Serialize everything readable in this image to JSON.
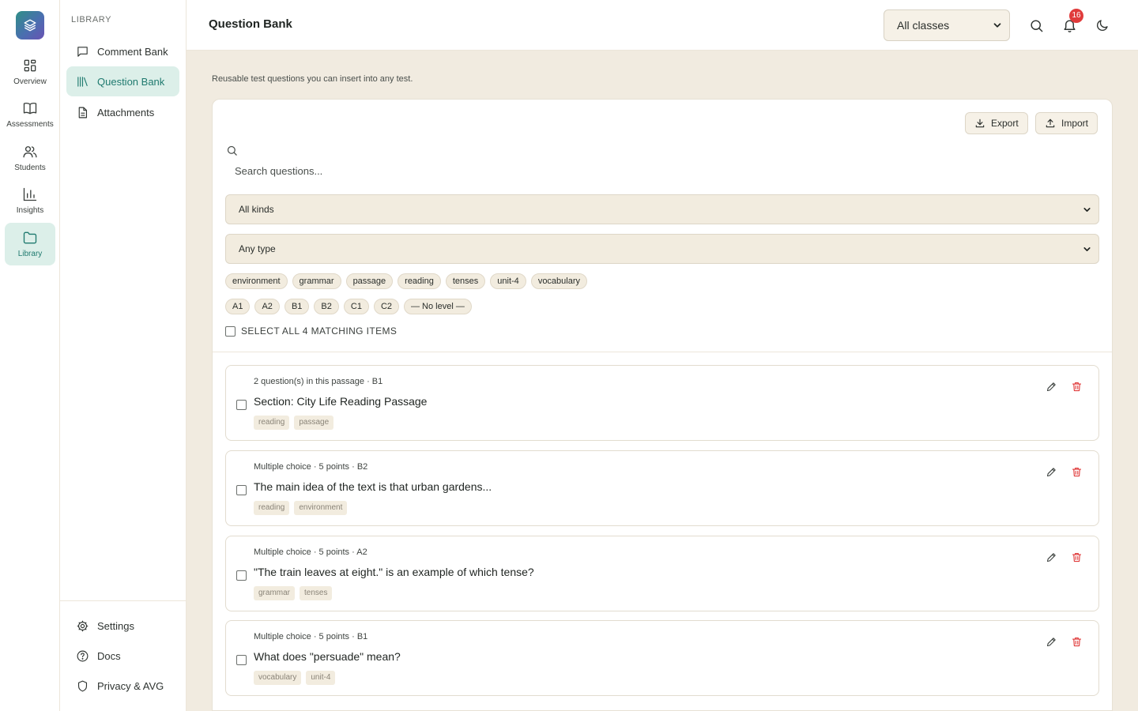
{
  "rail": {
    "items": [
      {
        "label": "Overview",
        "icon": "grid-icon"
      },
      {
        "label": "Assessments",
        "icon": "book-icon"
      },
      {
        "label": "Students",
        "icon": "users-icon"
      },
      {
        "label": "Insights",
        "icon": "bar-chart-icon"
      },
      {
        "label": "Library",
        "icon": "folder-icon",
        "active": true
      }
    ]
  },
  "sidebar": {
    "section_label": "LIBRARY",
    "items": [
      {
        "label": "Comment Bank",
        "icon": "message-square-icon"
      },
      {
        "label": "Question Bank",
        "icon": "library-icon",
        "active": true
      },
      {
        "label": "Attachments",
        "icon": "file-text-icon"
      }
    ],
    "footer_items": [
      {
        "label": "Settings",
        "icon": "gear-icon"
      },
      {
        "label": "Docs",
        "icon": "help-circle-icon"
      },
      {
        "label": "Privacy & AVG",
        "icon": "shield-icon"
      }
    ]
  },
  "header": {
    "title": "Question Bank",
    "class_filter": "All classes",
    "notification_count": "16"
  },
  "main": {
    "subtitle": "Reusable test questions you can insert into any test.",
    "export_label": "Export",
    "import_label": "Import",
    "search_placeholder": "Search questions...",
    "kind_filter": "All kinds",
    "type_filter": "Any type",
    "tags": [
      "environment",
      "grammar",
      "passage",
      "reading",
      "tenses",
      "unit-4",
      "vocabulary"
    ],
    "levels": [
      "A1",
      "A2",
      "B1",
      "B2",
      "C1",
      "C2",
      "— No level —"
    ],
    "select_all_label": "SELECT ALL 4 MATCHING ITEMS",
    "questions": [
      {
        "meta": "2 question(s) in this passage · B1",
        "title": "Section: City Life Reading Passage",
        "tags": [
          "reading",
          "passage"
        ]
      },
      {
        "meta": "Multiple choice · 5 points · B2",
        "title": "The main idea of the text is that urban gardens...",
        "tags": [
          "reading",
          "environment"
        ]
      },
      {
        "meta": "Multiple choice · 5 points · A2",
        "title": "\"The train leaves at eight.\" is an example of which tense?",
        "tags": [
          "grammar",
          "tenses"
        ]
      },
      {
        "meta": "Multiple choice · 5 points · B1",
        "title": "What does \"persuade\" mean?",
        "tags": [
          "vocabulary",
          "unit-4"
        ]
      }
    ]
  },
  "colors": {
    "accent": "#1f7a6f",
    "accent_bg": "#dcefe9",
    "page_bg": "#f1ebe0",
    "danger": "#e03b3b"
  }
}
